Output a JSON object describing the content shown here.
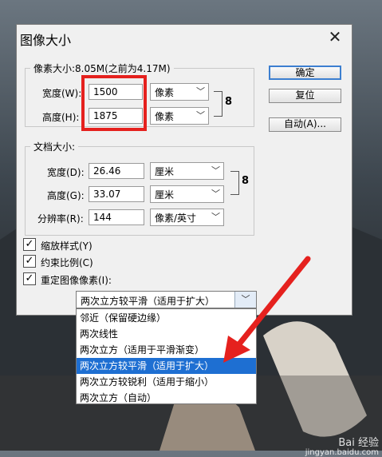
{
  "dialog": {
    "title": "图像大小",
    "close_glyph": "✕",
    "pixel_dims": {
      "legend": "像素大小:8.05M(之前为4.17M)",
      "width_label": "宽度(W):",
      "width_value": "1500",
      "width_unit": "像素",
      "height_label": "高度(H):",
      "height_value": "1875",
      "height_unit": "像素"
    },
    "doc_size": {
      "legend": "文档大小:",
      "width_label": "宽度(D):",
      "width_value": "26.46",
      "width_unit": "厘米",
      "height_label": "高度(G):",
      "height_value": "33.07",
      "height_unit": "厘米",
      "res_label": "分辨率(R):",
      "res_value": "144",
      "res_unit": "像素/英寸"
    },
    "buttons": {
      "ok": "确定",
      "reset": "复位",
      "auto": "自动(A)..."
    },
    "checkboxes": [
      {
        "label": "缩放样式(Y)",
        "checked": true
      },
      {
        "label": "约束比例(C)",
        "checked": true
      },
      {
        "label": "重定图像像素(I):",
        "checked": true
      }
    ],
    "link_icon": "8"
  },
  "resample": {
    "selected": "两次立方较平滑（适用于扩大）",
    "options": [
      "邻近（保留硬边缘）",
      "两次线性",
      "两次立方（适用于平滑渐变）",
      "两次立方较平滑（适用于扩大）",
      "两次立方较锐利（适用于缩小）",
      "两次立方（自动）"
    ],
    "highlighted_index": 3
  },
  "watermark": {
    "brand": "Bai 经验",
    "url": "jingyan.baidu.com"
  },
  "colors": {
    "highlight": "#1e6fd2",
    "annotation_red": "#e5211e"
  }
}
